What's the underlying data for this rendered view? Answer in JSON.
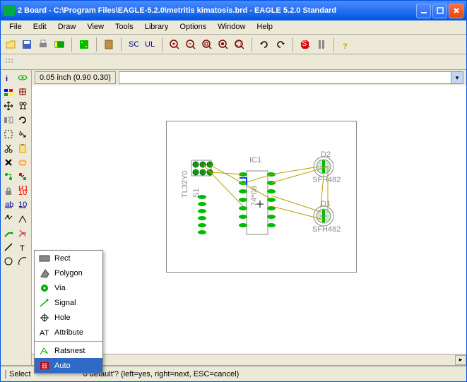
{
  "titlebar": {
    "title": "2 Board - C:\\Program Files\\EAGLE-5.2.0\\metritis kimatosis.brd - EAGLE 5.2.0 Standard"
  },
  "menubar": {
    "items": [
      "File",
      "Edit",
      "Draw",
      "View",
      "Tools",
      "Library",
      "Options",
      "Window",
      "Help"
    ]
  },
  "coord": {
    "text": "0.05 inch (0.90 0.30)"
  },
  "status": {
    "prefix": "Select",
    "message": "0 default'? (left=yes, right=next, ESC=cancel)"
  },
  "context_menu": {
    "items": [
      {
        "label": "Rect",
        "selected": false
      },
      {
        "label": "Polygon",
        "selected": false
      },
      {
        "label": "Via",
        "selected": false
      },
      {
        "label": "Signal",
        "selected": false
      },
      {
        "label": "Hole",
        "selected": false
      },
      {
        "label": "Attribute",
        "selected": false
      },
      {
        "label": "Ratsnest",
        "selected": false
      },
      {
        "label": "Auto",
        "selected": true
      }
    ]
  },
  "board": {
    "components": [
      {
        "ref": "S1",
        "type": "TL32Y0"
      },
      {
        "ref": "IC1"
      },
      {
        "ref": "D2",
        "type": "SFH482"
      },
      {
        "ref": "D1",
        "type": "SFH482"
      }
    ]
  }
}
